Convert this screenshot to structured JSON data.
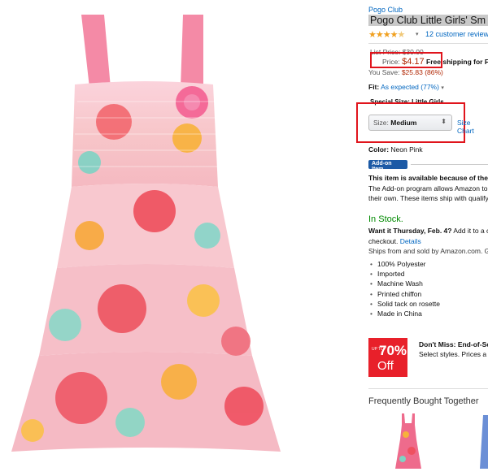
{
  "product": {
    "brand": "Pogo Club",
    "title": "Pogo Club Little Girls' Sm",
    "rating_stars": "★★★★",
    "rating_half": "★",
    "reviews": "12 customer reviews",
    "list_price_label": "List Price:",
    "list_price": "$30.00",
    "price_label": "Price:",
    "price": "$4.17",
    "free": "Free",
    "shipping": "shipping for F",
    "save_label": "You Save:",
    "save_value": "$25.83 (86%)",
    "fit_label": "Fit:",
    "fit_value": "As expected (77%)",
    "special_sizes": "Special Size: Little Girls",
    "size_label": "Size:",
    "size_value": "Medium",
    "size_chart": "Size Chart",
    "color_label": "Color:",
    "color_value": "Neon Pink",
    "addon_badge": "Add-on Item",
    "addon_head": "This item is available because of the",
    "addon_text1": "The Add-on program allows Amazon to",
    "addon_text2": "their own. These items ship with qualify",
    "in_stock": "In Stock.",
    "want_bold": "Want it Thursday, Feb. 4?",
    "want_rest": "Add it to a c",
    "checkout": "checkout.",
    "details": "Details",
    "ships": "Ships from and sold by Amazon.com. G",
    "bullets": [
      "100% Polyester",
      "Imported",
      "Machine Wash",
      "Printed chiffon",
      "Solid tack on rosette",
      "Made in China"
    ],
    "promo_up": "UP TO",
    "promo_pct": "70%",
    "promo_off": "Off",
    "promo_head": "Don't Miss: End-of-Se",
    "promo_text": "Select styles. Prices a",
    "fbt": "Frequently Bought Together"
  },
  "colors": {
    "link": "#0066c0",
    "price": "#b12704",
    "instock": "#008a00",
    "highlight": "#e0141c"
  }
}
